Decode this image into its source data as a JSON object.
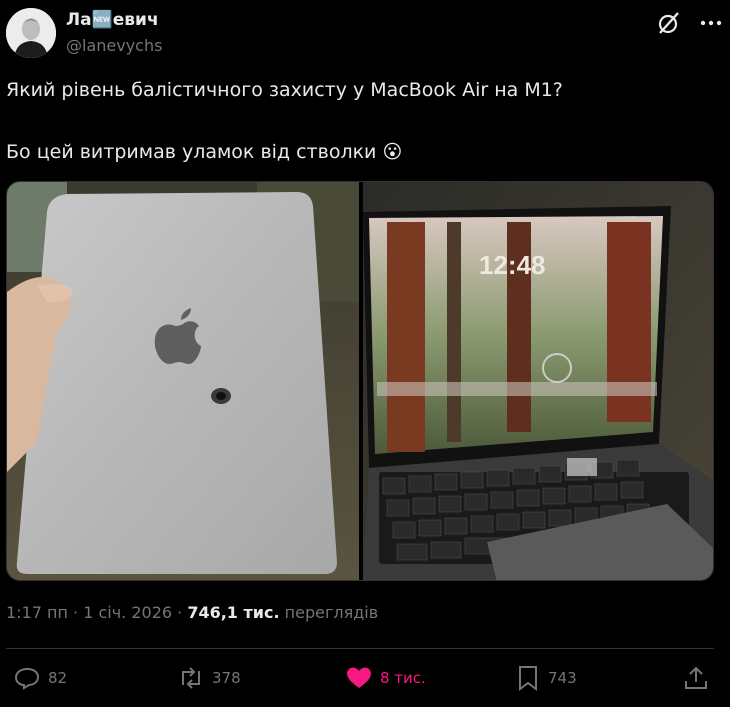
{
  "author": {
    "name": "Ла🆕евич",
    "handle": "@lanevychs"
  },
  "tweet": {
    "line1": "Який рівень балістичного захисту у MacBook Air на M1?",
    "line2": "Бо цей витримав уламок від стволки 😮"
  },
  "media": {
    "lock_time": "12:48"
  },
  "meta": {
    "time": "1:17 пп",
    "sep1": " · ",
    "date": "1 січ. 2026",
    "sep2": " · ",
    "views_count": "746,1 тис.",
    "views_label": " переглядів"
  },
  "actions": {
    "replies": "82",
    "reposts": "378",
    "likes": "8 тис.",
    "bookmarks": "743"
  },
  "colors": {
    "like": "#f91880",
    "muted": "#71767b",
    "text": "#e7e9ea"
  }
}
